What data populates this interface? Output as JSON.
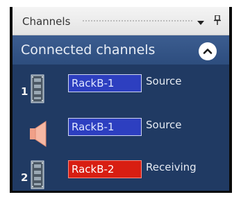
{
  "titlebar": {
    "title": "Channels",
    "dropdown_glyph": "▾",
    "pin_glyph": "⊥"
  },
  "panel": {
    "title": "Connected channels",
    "collapse_icon": "chevron-up-icon"
  },
  "rows": [
    {
      "number": "1",
      "icon": "rack-device-icon",
      "channel": "RackB-1",
      "status": "Source",
      "color": "#2d3fc0"
    },
    {
      "number": "",
      "icon": "speaker-icon",
      "channel": "RackB-1",
      "status": "Source",
      "color": "#2d3fc0"
    },
    {
      "number": "2",
      "icon": "rack-device-icon",
      "channel": "RackB-2",
      "status": "Receiving",
      "color": "#d81e12"
    }
  ],
  "colors": {
    "panel_bg": "#203a63",
    "header_bg": "#3c5d90",
    "chip_source": "#2d3fc0",
    "chip_receiving": "#d81e12"
  }
}
